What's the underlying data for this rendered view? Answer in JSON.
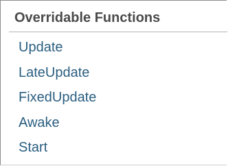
{
  "panel": {
    "title": "Overridable Functions",
    "items": [
      {
        "label": "Update"
      },
      {
        "label": "LateUpdate"
      },
      {
        "label": "FixedUpdate"
      },
      {
        "label": "Awake"
      },
      {
        "label": "Start"
      }
    ]
  },
  "colors": {
    "header_text": "#4a4a4a",
    "link_text": "#2a5e80"
  }
}
